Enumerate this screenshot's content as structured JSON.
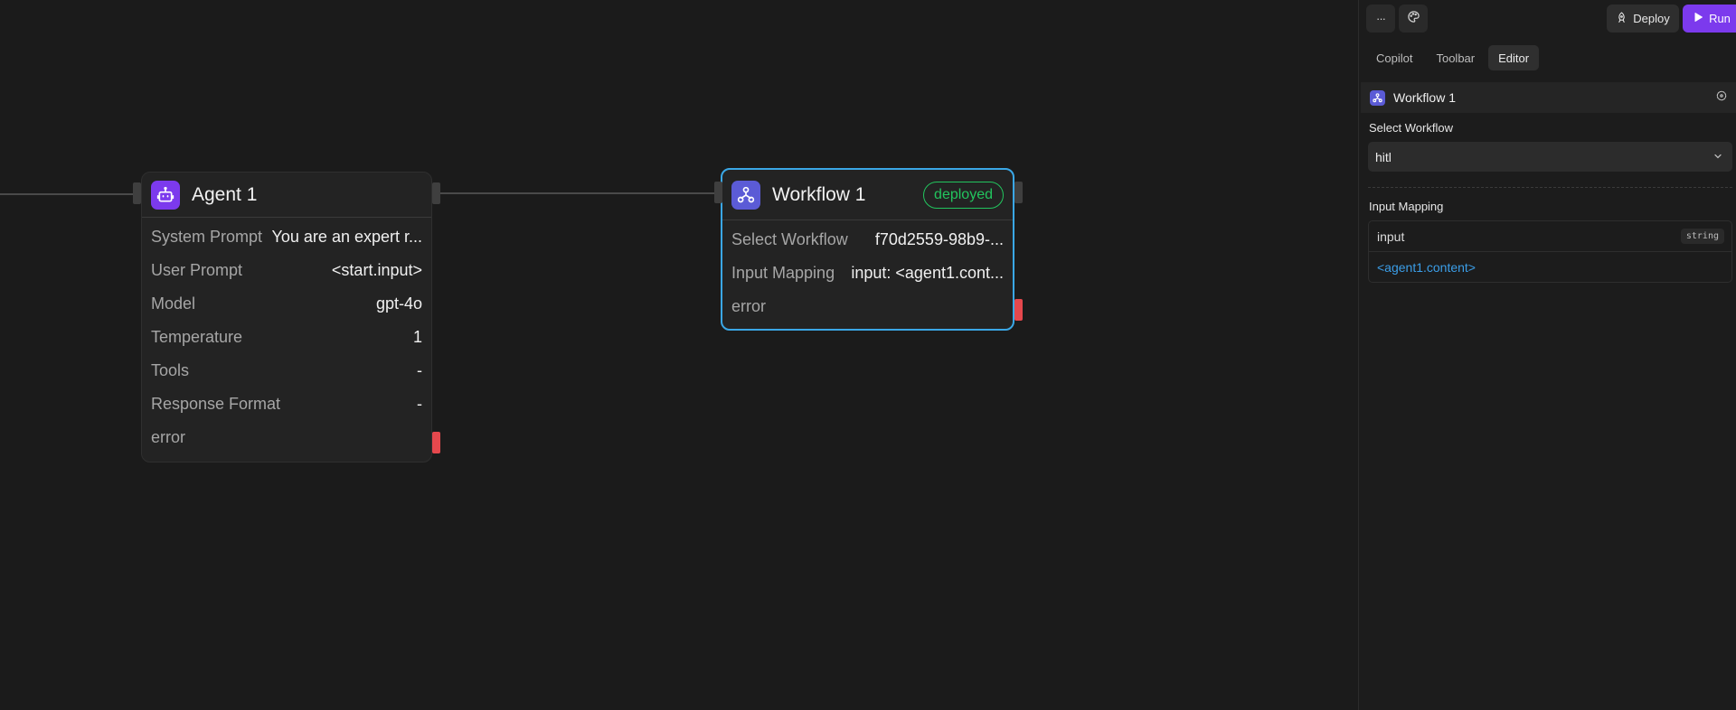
{
  "canvas": {
    "agent_node": {
      "title": "Agent 1",
      "icon": "robot-icon",
      "rows": [
        {
          "label": "System Prompt",
          "value": "You are an expert r..."
        },
        {
          "label": "User Prompt",
          "value": "<start.input>"
        },
        {
          "label": "Model",
          "value": "gpt-4o"
        },
        {
          "label": "Temperature",
          "value": "1"
        },
        {
          "label": "Tools",
          "value": "-"
        },
        {
          "label": "Response Format",
          "value": "-"
        },
        {
          "label": "error",
          "value": ""
        }
      ],
      "icon_color": "#7c3aed"
    },
    "workflow_node": {
      "title": "Workflow 1",
      "badge": "deployed",
      "icon": "workflow-icon",
      "rows": [
        {
          "label": "Select Workflow",
          "value": "f70d2559-98b9-..."
        },
        {
          "label": "Input Mapping",
          "value": "input: <agent1.cont..."
        },
        {
          "label": "error",
          "value": ""
        }
      ],
      "icon_color": "#5b5bd6",
      "selected_border_color": "#3aa7e6",
      "badge_color": "#22c55e",
      "error_handle_color": "#e5484d"
    }
  },
  "panel": {
    "toolbar": {
      "more_icon": "more-horizontal-icon",
      "more_glyph": "···",
      "palette_icon": "palette-icon",
      "deploy_label": "Deploy",
      "deploy_icon": "rocket-icon",
      "run_label": "Run",
      "run_icon": "play-icon",
      "run_color": "#7c3aed"
    },
    "tabs": [
      {
        "label": "Copilot",
        "active": false
      },
      {
        "label": "Toolbar",
        "active": false
      },
      {
        "label": "Editor",
        "active": true
      }
    ],
    "block": {
      "title": "Workflow 1",
      "icon": "workflow-icon",
      "action_icon": "crosshair-icon"
    },
    "select_workflow": {
      "label": "Select Workflow",
      "value": "hitl",
      "chevron_icon": "chevron-down-icon"
    },
    "input_mapping": {
      "label": "Input Mapping",
      "field_name": "input",
      "field_type": "string",
      "field_value": "<agent1.content>"
    }
  }
}
